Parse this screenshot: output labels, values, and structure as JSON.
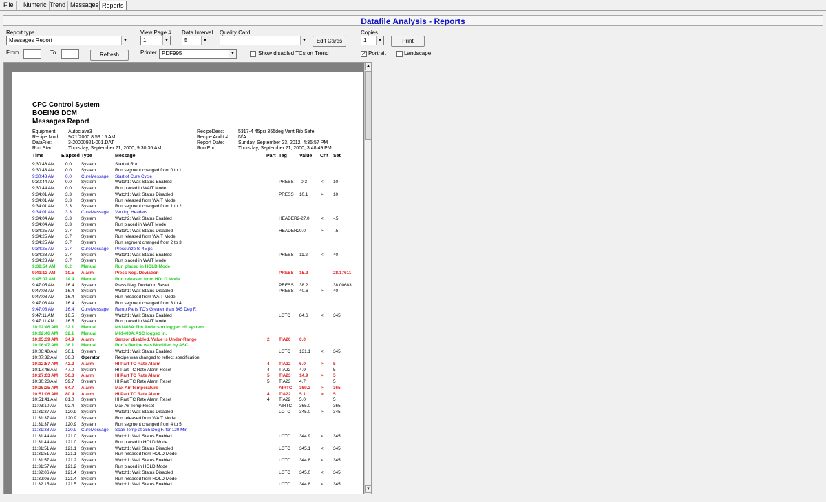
{
  "tabs": [
    {
      "label": "File"
    },
    {
      "label": "Numeric"
    },
    {
      "label": "Trend"
    },
    {
      "label": "Messages"
    },
    {
      "label": "Reports",
      "active": true
    }
  ],
  "title": "Datafile Analysis - Reports",
  "controls": {
    "report_type_label": "Report type...",
    "report_type_value": "Messages Report",
    "view_page_label": "View Page #",
    "view_page_value": "1",
    "data_interval_label": "Data Interval",
    "data_interval_value": "5",
    "quality_card_label": "Quality Card",
    "quality_card_value": "",
    "edit_cards_label": "Edit Cards",
    "copies_label": "Copies",
    "copies_value": "1",
    "print_label": "Print",
    "from_label": "From",
    "to_label": "To",
    "from_value": "",
    "to_value": "",
    "refresh_label": "Refresh",
    "printer_label": "Printer",
    "printer_value": "PDF995",
    "show_disabled_label": "Show disabled TCs on Trend",
    "show_disabled_checked": false,
    "portrait_label": "Portrait",
    "portrait_checked": true,
    "landscape_label": "Landscape",
    "landscape_checked": false
  },
  "report": {
    "title_lines": [
      "CPC Control System",
      "BOEING DCM",
      "Messages Report"
    ],
    "header_left": [
      {
        "label": "Equipment:",
        "value": "Autoclave3"
      },
      {
        "label": "Recipe Mod:",
        "value": "9/21/2000 8:59:15 AM"
      },
      {
        "label": "DataFile:",
        "value": "3-20000921-001.DAT"
      },
      {
        "label": "Run Start:",
        "value": "Thursday, September 21, 2000, 9:30:36 AM"
      }
    ],
    "header_right": [
      {
        "label": "RecipeDesc:",
        "value": "5317-4 45psi 355deg Vent Rib Safe"
      },
      {
        "label": "Recipe Audit #:",
        "value": "N/A"
      },
      {
        "label": "Report Date:",
        "value": "Sunday, September 23, 2012, 4:35:57 PM"
      },
      {
        "label": "Run End:",
        "value": "Thursday, September 21, 2000, 3:48:49 PM"
      }
    ],
    "columns": {
      "time": "Time",
      "elapsed": "Elapsed",
      "type": "Type",
      "message": "Message",
      "part": "Part",
      "tag": "Tag",
      "value": "Value",
      "crit": "Crit",
      "set": "Set"
    },
    "rows": [
      {
        "t": "9:30:43 AM",
        "e": "0.0",
        "ty": "System",
        "m": "Start of Run",
        "p": "",
        "tag": "",
        "v": "",
        "c": "",
        "s": "",
        "k": "system"
      },
      {
        "t": "9:30:43 AM",
        "e": "0.0",
        "ty": "System",
        "m": "Run segment changed from 0 to 1",
        "p": "",
        "tag": "",
        "v": "",
        "c": "",
        "s": "",
        "k": "system"
      },
      {
        "t": "9:30:43 AM",
        "e": "0.0",
        "ty": "CureMessage",
        "m": "Start of Cure Cycle",
        "p": "",
        "tag": "",
        "v": "",
        "c": "",
        "s": "",
        "k": "cure"
      },
      {
        "t": "9:30:44 AM",
        "e": "0.0",
        "ty": "System",
        "m": "Watch1: Wait Status Enabled",
        "p": "",
        "tag": "PRESS",
        "v": "-0.3",
        "c": "<",
        "s": "10",
        "k": "system"
      },
      {
        "t": "9:30:44 AM",
        "e": "0.0",
        "ty": "System",
        "m": "Run placed in WAIT Mode",
        "p": "",
        "tag": "",
        "v": "",
        "c": "",
        "s": "",
        "k": "system"
      },
      {
        "t": "9:34:01 AM",
        "e": "3.3",
        "ty": "System",
        "m": "Watch1: Wait Status Disabled",
        "p": "",
        "tag": "PRESS",
        "v": "10.1",
        "c": ">",
        "s": "10",
        "k": "system"
      },
      {
        "t": "9:34:01 AM",
        "e": "3.3",
        "ty": "System",
        "m": "Run released from WAIT Mode",
        "p": "",
        "tag": "",
        "v": "",
        "c": "",
        "s": "",
        "k": "system"
      },
      {
        "t": "9:34:01 AM",
        "e": "3.3",
        "ty": "System",
        "m": "Run segment changed from 1 to 2",
        "p": "",
        "tag": "",
        "v": "",
        "c": "",
        "s": "",
        "k": "system"
      },
      {
        "t": "9:34:01 AM",
        "e": "3.3",
        "ty": "CureMessage",
        "m": "Venting Headers",
        "p": "",
        "tag": "",
        "v": "",
        "c": "",
        "s": "",
        "k": "cure"
      },
      {
        "t": "9:34:04 AM",
        "e": "3.3",
        "ty": "System",
        "m": "Watch2: Wait Status Enabled",
        "p": "",
        "tag": "HEADER2",
        "v": "-27.0",
        "c": "<",
        "s": "-.5",
        "k": "system"
      },
      {
        "t": "9:34:04 AM",
        "e": "3.3",
        "ty": "System",
        "m": "Run placed in WAIT Mode",
        "p": "",
        "tag": "",
        "v": "",
        "c": "",
        "s": "",
        "k": "system"
      },
      {
        "t": "9:34:25 AM",
        "e": "3.7",
        "ty": "System",
        "m": "Watch2: Wait Status Disabled",
        "p": "",
        "tag": "HEADER2",
        "v": "0.0",
        "c": ">",
        "s": "-.5",
        "k": "system"
      },
      {
        "t": "9:34:25 AM",
        "e": "3.7",
        "ty": "System",
        "m": "Run released from WAIT Mode",
        "p": "",
        "tag": "",
        "v": "",
        "c": "",
        "s": "",
        "k": "system"
      },
      {
        "t": "9:34:25 AM",
        "e": "3.7",
        "ty": "System",
        "m": "Run segment changed from 2 to 3",
        "p": "",
        "tag": "",
        "v": "",
        "c": "",
        "s": "",
        "k": "system"
      },
      {
        "t": "9:34:25 AM",
        "e": "3.7",
        "ty": "CureMessage",
        "m": "Pressurize to 45 psi",
        "p": "",
        "tag": "",
        "v": "",
        "c": "",
        "s": "",
        "k": "cure"
      },
      {
        "t": "9:34:28 AM",
        "e": "3.7",
        "ty": "System",
        "m": "Watch1: Wait Status Enabled",
        "p": "",
        "tag": "PRESS",
        "v": "11.2",
        "c": "<",
        "s": "40",
        "k": "system"
      },
      {
        "t": "9:34:28 AM",
        "e": "3.7",
        "ty": "System",
        "m": "Run placed in WAIT Mode",
        "p": "",
        "tag": "",
        "v": "",
        "c": "",
        "s": "",
        "k": "system"
      },
      {
        "t": "9:38:54 AM",
        "e": "8.2",
        "ty": "Manual",
        "m": "Run placed in HOLD Mode",
        "p": "",
        "tag": "",
        "v": "",
        "c": "",
        "s": "",
        "k": "manual"
      },
      {
        "t": "9:41:12 AM",
        "e": "10.5",
        "ty": "Alarm",
        "m": "Press Neg. Deviation",
        "p": "",
        "tag": "PRESS",
        "v": "15.2",
        "c": "",
        "s": "28.17611",
        "k": "alarm"
      },
      {
        "t": "9:45:07 AM",
        "e": "14.4",
        "ty": "Manual",
        "m": "Run released from HOLD Mode",
        "p": "",
        "tag": "",
        "v": "",
        "c": "",
        "s": "",
        "k": "manual"
      },
      {
        "t": "9:47:05 AM",
        "e": "16.4",
        "ty": "System",
        "m": "Press Neg. Deviation Reset",
        "p": "",
        "tag": "PRESS",
        "v": "38.2",
        "c": "",
        "s": "38.00683",
        "k": "system"
      },
      {
        "t": "9:47:08 AM",
        "e": "16.4",
        "ty": "System",
        "m": "Watch1: Wait Status Disabled",
        "p": "",
        "tag": "PRESS",
        "v": "40.6",
        "c": ">",
        "s": "40",
        "k": "system"
      },
      {
        "t": "9:47:08 AM",
        "e": "16.4",
        "ty": "System",
        "m": "Run released from WAIT Mode",
        "p": "",
        "tag": "",
        "v": "",
        "c": "",
        "s": "",
        "k": "system"
      },
      {
        "t": "9:47:08 AM",
        "e": "16.4",
        "ty": "System",
        "m": "Run segment changed from 3 to 4",
        "p": "",
        "tag": "",
        "v": "",
        "c": "",
        "s": "",
        "k": "system"
      },
      {
        "t": "9:47:08 AM",
        "e": "16.4",
        "ty": "CureMessage",
        "m": "Ramp Parts TC's Greater than 345 Deg F.",
        "p": "",
        "tag": "",
        "v": "",
        "c": "",
        "s": "",
        "k": "cure"
      },
      {
        "t": "9:47:11 AM",
        "e": "16.5",
        "ty": "System",
        "m": "Watch1: Wait Status Enabled",
        "p": "",
        "tag": "LOTC",
        "v": "84.6",
        "c": "<",
        "s": "345",
        "k": "system"
      },
      {
        "t": "9:47:11 AM",
        "e": "16.5",
        "ty": "System",
        "m": "Run placed in WAIT Mode",
        "p": "",
        "tag": "",
        "v": "",
        "c": "",
        "s": "",
        "k": "system"
      },
      {
        "t": "10:02:46 AM",
        "e": "32.1",
        "ty": "Manual",
        "m": "M61403A:Tim Anderson logged off system.",
        "p": "",
        "tag": "",
        "v": "",
        "c": "",
        "s": "",
        "k": "manual"
      },
      {
        "t": "10:02:46 AM",
        "e": "32.1",
        "ty": "Manual",
        "m": "M61403A:ASC logged in.",
        "p": "",
        "tag": "",
        "v": "",
        "c": "",
        "s": "",
        "k": "manual"
      },
      {
        "t": "10:05:39 AM",
        "e": "34.9",
        "ty": "Alarm",
        "m": "Sensor disabled.  Value is Under-Range",
        "p": "2",
        "tag": "TIA20",
        "v": "0.0",
        "c": "",
        "s": "",
        "k": "alarm"
      },
      {
        "t": "10:06:47 AM",
        "e": "36.1",
        "ty": "Manual",
        "m": "Run's Recipe was Modified by ASC",
        "p": "",
        "tag": "",
        "v": "",
        "c": "",
        "s": "",
        "k": "manual"
      },
      {
        "t": "10:06:48 AM",
        "e": "36.1",
        "ty": "System",
        "m": "Watch1: Wait Status Enabled",
        "p": "",
        "tag": "LOTC",
        "v": "131.1",
        "c": "<",
        "s": "345",
        "k": "system"
      },
      {
        "t": "10:07:32 AM",
        "e": "36.8",
        "ty": "Operator",
        "m": "Recipe was changed to reflect specification",
        "p": "",
        "tag": "",
        "v": "",
        "c": "",
        "s": "",
        "k": "operator"
      },
      {
        "t": "10:12:57 AM",
        "e": "42.2",
        "ty": "Alarm",
        "m": "HI Part TC Rate Alarm",
        "p": "4",
        "tag": "TIA22",
        "v": "6.0",
        "c": ">",
        "s": "5",
        "k": "alarm"
      },
      {
        "t": "10:17:46 AM",
        "e": "47.0",
        "ty": "System",
        "m": "HI Part TC Rate Alarm Reset",
        "p": "4",
        "tag": "TIA22",
        "v": "4.9",
        "c": "",
        "s": "5",
        "k": "system"
      },
      {
        "t": "10:27:03 AM",
        "e": "56.3",
        "ty": "Alarm",
        "m": "HI Part TC Rate Alarm",
        "p": "5",
        "tag": "TIA23",
        "v": "14.9",
        "c": ">",
        "s": "5",
        "k": "alarm"
      },
      {
        "t": "10:30:23 AM",
        "e": "59.7",
        "ty": "System",
        "m": "HI Part TC Rate Alarm Reset",
        "p": "5",
        "tag": "TIA23",
        "v": "4.7",
        "c": "",
        "s": "5",
        "k": "system"
      },
      {
        "t": "10:35:25 AM",
        "e": "64.7",
        "ty": "Alarm",
        "m": "Max Air Temperature",
        "p": "",
        "tag": "AIRTC",
        "v": "369.2",
        "c": ">",
        "s": "365",
        "k": "alarm"
      },
      {
        "t": "10:51:06 AM",
        "e": "80.4",
        "ty": "Alarm",
        "m": "HI Part TC Rate Alarm",
        "p": "4",
        "tag": "TIA22",
        "v": "5.1",
        "c": ">",
        "s": "5",
        "k": "alarm"
      },
      {
        "t": "10:51:41 AM",
        "e": "81.0",
        "ty": "System",
        "m": "HI Part TC Rate Alarm Reset",
        "p": "4",
        "tag": "TIA22",
        "v": "5.0",
        "c": "",
        "s": "5",
        "k": "system"
      },
      {
        "t": "11:03:10 AM",
        "e": "92.4",
        "ty": "System",
        "m": "Max Air Temp Reset",
        "p": "",
        "tag": "AIRTC",
        "v": "365.0",
        "c": "",
        "s": "365",
        "k": "system"
      },
      {
        "t": "11:31:37 AM",
        "e": "120.9",
        "ty": "System",
        "m": "Watch1: Wait Status Disabled",
        "p": "",
        "tag": "LOTC",
        "v": "345.0",
        "c": ">",
        "s": "345",
        "k": "system"
      },
      {
        "t": "11:31:37 AM",
        "e": "120.9",
        "ty": "System",
        "m": "Run released from WAIT Mode",
        "p": "",
        "tag": "",
        "v": "",
        "c": "",
        "s": "",
        "k": "system"
      },
      {
        "t": "11:31:37 AM",
        "e": "120.9",
        "ty": "System",
        "m": "Run segment changed from 4 to 5",
        "p": "",
        "tag": "",
        "v": "",
        "c": "",
        "s": "",
        "k": "system"
      },
      {
        "t": "11:31:38 AM",
        "e": "120.9",
        "ty": "CureMessage",
        "m": "Soak Temp at 355 Deg F. for 120 Min",
        "p": "",
        "tag": "",
        "v": "",
        "c": "",
        "s": "",
        "k": "cure"
      },
      {
        "t": "11:31:44 AM",
        "e": "121.0",
        "ty": "System",
        "m": "Watch1: Wait Status Enabled",
        "p": "",
        "tag": "LOTC",
        "v": "344.9",
        "c": "<",
        "s": "345",
        "k": "system"
      },
      {
        "t": "11:31:44 AM",
        "e": "121.0",
        "ty": "System",
        "m": "Run placed in HOLD Mode",
        "p": "",
        "tag": "",
        "v": "",
        "c": "",
        "s": "",
        "k": "system"
      },
      {
        "t": "11:31:51 AM",
        "e": "121.1",
        "ty": "System",
        "m": "Watch1: Wait Status Disabled",
        "p": "",
        "tag": "LOTC",
        "v": "345.1",
        "c": "<",
        "s": "345",
        "k": "system"
      },
      {
        "t": "11:31:51 AM",
        "e": "121.1",
        "ty": "System",
        "m": "Run released from HOLD Mode",
        "p": "",
        "tag": "",
        "v": "",
        "c": "",
        "s": "",
        "k": "system"
      },
      {
        "t": "11:31:57 AM",
        "e": "121.2",
        "ty": "System",
        "m": "Watch1: Wait Status Enabled",
        "p": "",
        "tag": "LOTC",
        "v": "344.8",
        "c": "<",
        "s": "345",
        "k": "system"
      },
      {
        "t": "11:31:57 AM",
        "e": "121.2",
        "ty": "System",
        "m": "Run placed in HOLD Mode",
        "p": "",
        "tag": "",
        "v": "",
        "c": "",
        "s": "",
        "k": "system"
      },
      {
        "t": "11:32:06 AM",
        "e": "121.4",
        "ty": "System",
        "m": "Watch1: Wait Status Disabled",
        "p": "",
        "tag": "LOTC",
        "v": "345.0",
        "c": "<",
        "s": "345",
        "k": "system"
      },
      {
        "t": "11:32:06 AM",
        "e": "121.4",
        "ty": "System",
        "m": "Run released from HOLD Mode",
        "p": "",
        "tag": "",
        "v": "",
        "c": "",
        "s": "",
        "k": "system"
      },
      {
        "t": "11:32:15 AM",
        "e": "121.5",
        "ty": "System",
        "m": "Watch1: Wait Status Enabled",
        "p": "",
        "tag": "LOTC",
        "v": "344.8",
        "c": "<",
        "s": "345",
        "k": "system"
      }
    ]
  }
}
